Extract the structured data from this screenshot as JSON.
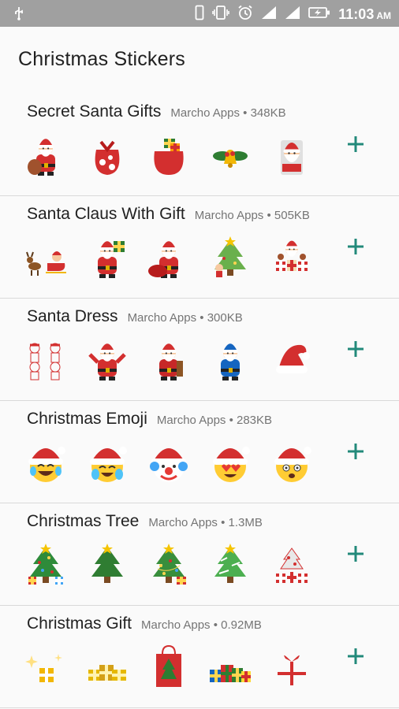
{
  "status_bar": {
    "time": "11:03",
    "ampm": "AM",
    "icons": [
      "usb-icon",
      "phone-icon",
      "vibrate-icon",
      "alarm-icon",
      "signal-icon",
      "signal-icon",
      "battery-charging-icon"
    ]
  },
  "app": {
    "title": "Christmas Stickers"
  },
  "colors": {
    "accent": "#22897a",
    "divider": "#d9d9d9",
    "status_bar": "#a0a0a0"
  },
  "packs": [
    {
      "name": "Secret Santa Gifts",
      "author": "Marcho Apps",
      "size": "348KB",
      "stickers": [
        "santa-gift-sack",
        "red-gift-sack",
        "santa-sack-red",
        "bells-holly",
        "santa-peek"
      ]
    },
    {
      "name": "Santa Claus With Gift",
      "author": "Marcho Apps",
      "size": "505KB",
      "stickers": [
        "santa-sleigh-reindeer",
        "santa-holding-gift",
        "santa-carrying-sack",
        "santa-tree-kids",
        "santa-toys"
      ]
    },
    {
      "name": "Santa Dress",
      "author": "Marcho Apps",
      "size": "300KB",
      "stickers": [
        "santa-sketch",
        "santa-waving",
        "santa-standing",
        "santa-blue",
        "santa-hat"
      ]
    },
    {
      "name": "Christmas Emoji",
      "author": "Marcho Apps",
      "size": "283KB",
      "stickers": [
        "emoji-laughing-tears",
        "emoji-crying-laughing",
        "emoji-clown",
        "emoji-heart-eyes",
        "emoji-shocked"
      ]
    },
    {
      "name": "Christmas Tree",
      "author": "Marcho Apps",
      "size": "1.3MB",
      "stickers": [
        "tree-decorated",
        "tree-plain",
        "tree-lights",
        "tree-snowy",
        "tree-gifts"
      ]
    },
    {
      "name": "Christmas Gift",
      "author": "Marcho Apps",
      "size": "0.92MB",
      "stickers": [
        "gift-sparkle",
        "gift-pile-gold",
        "gift-bag-tree",
        "gift-pile-colorful",
        "gift-box-bow"
      ]
    }
  ]
}
